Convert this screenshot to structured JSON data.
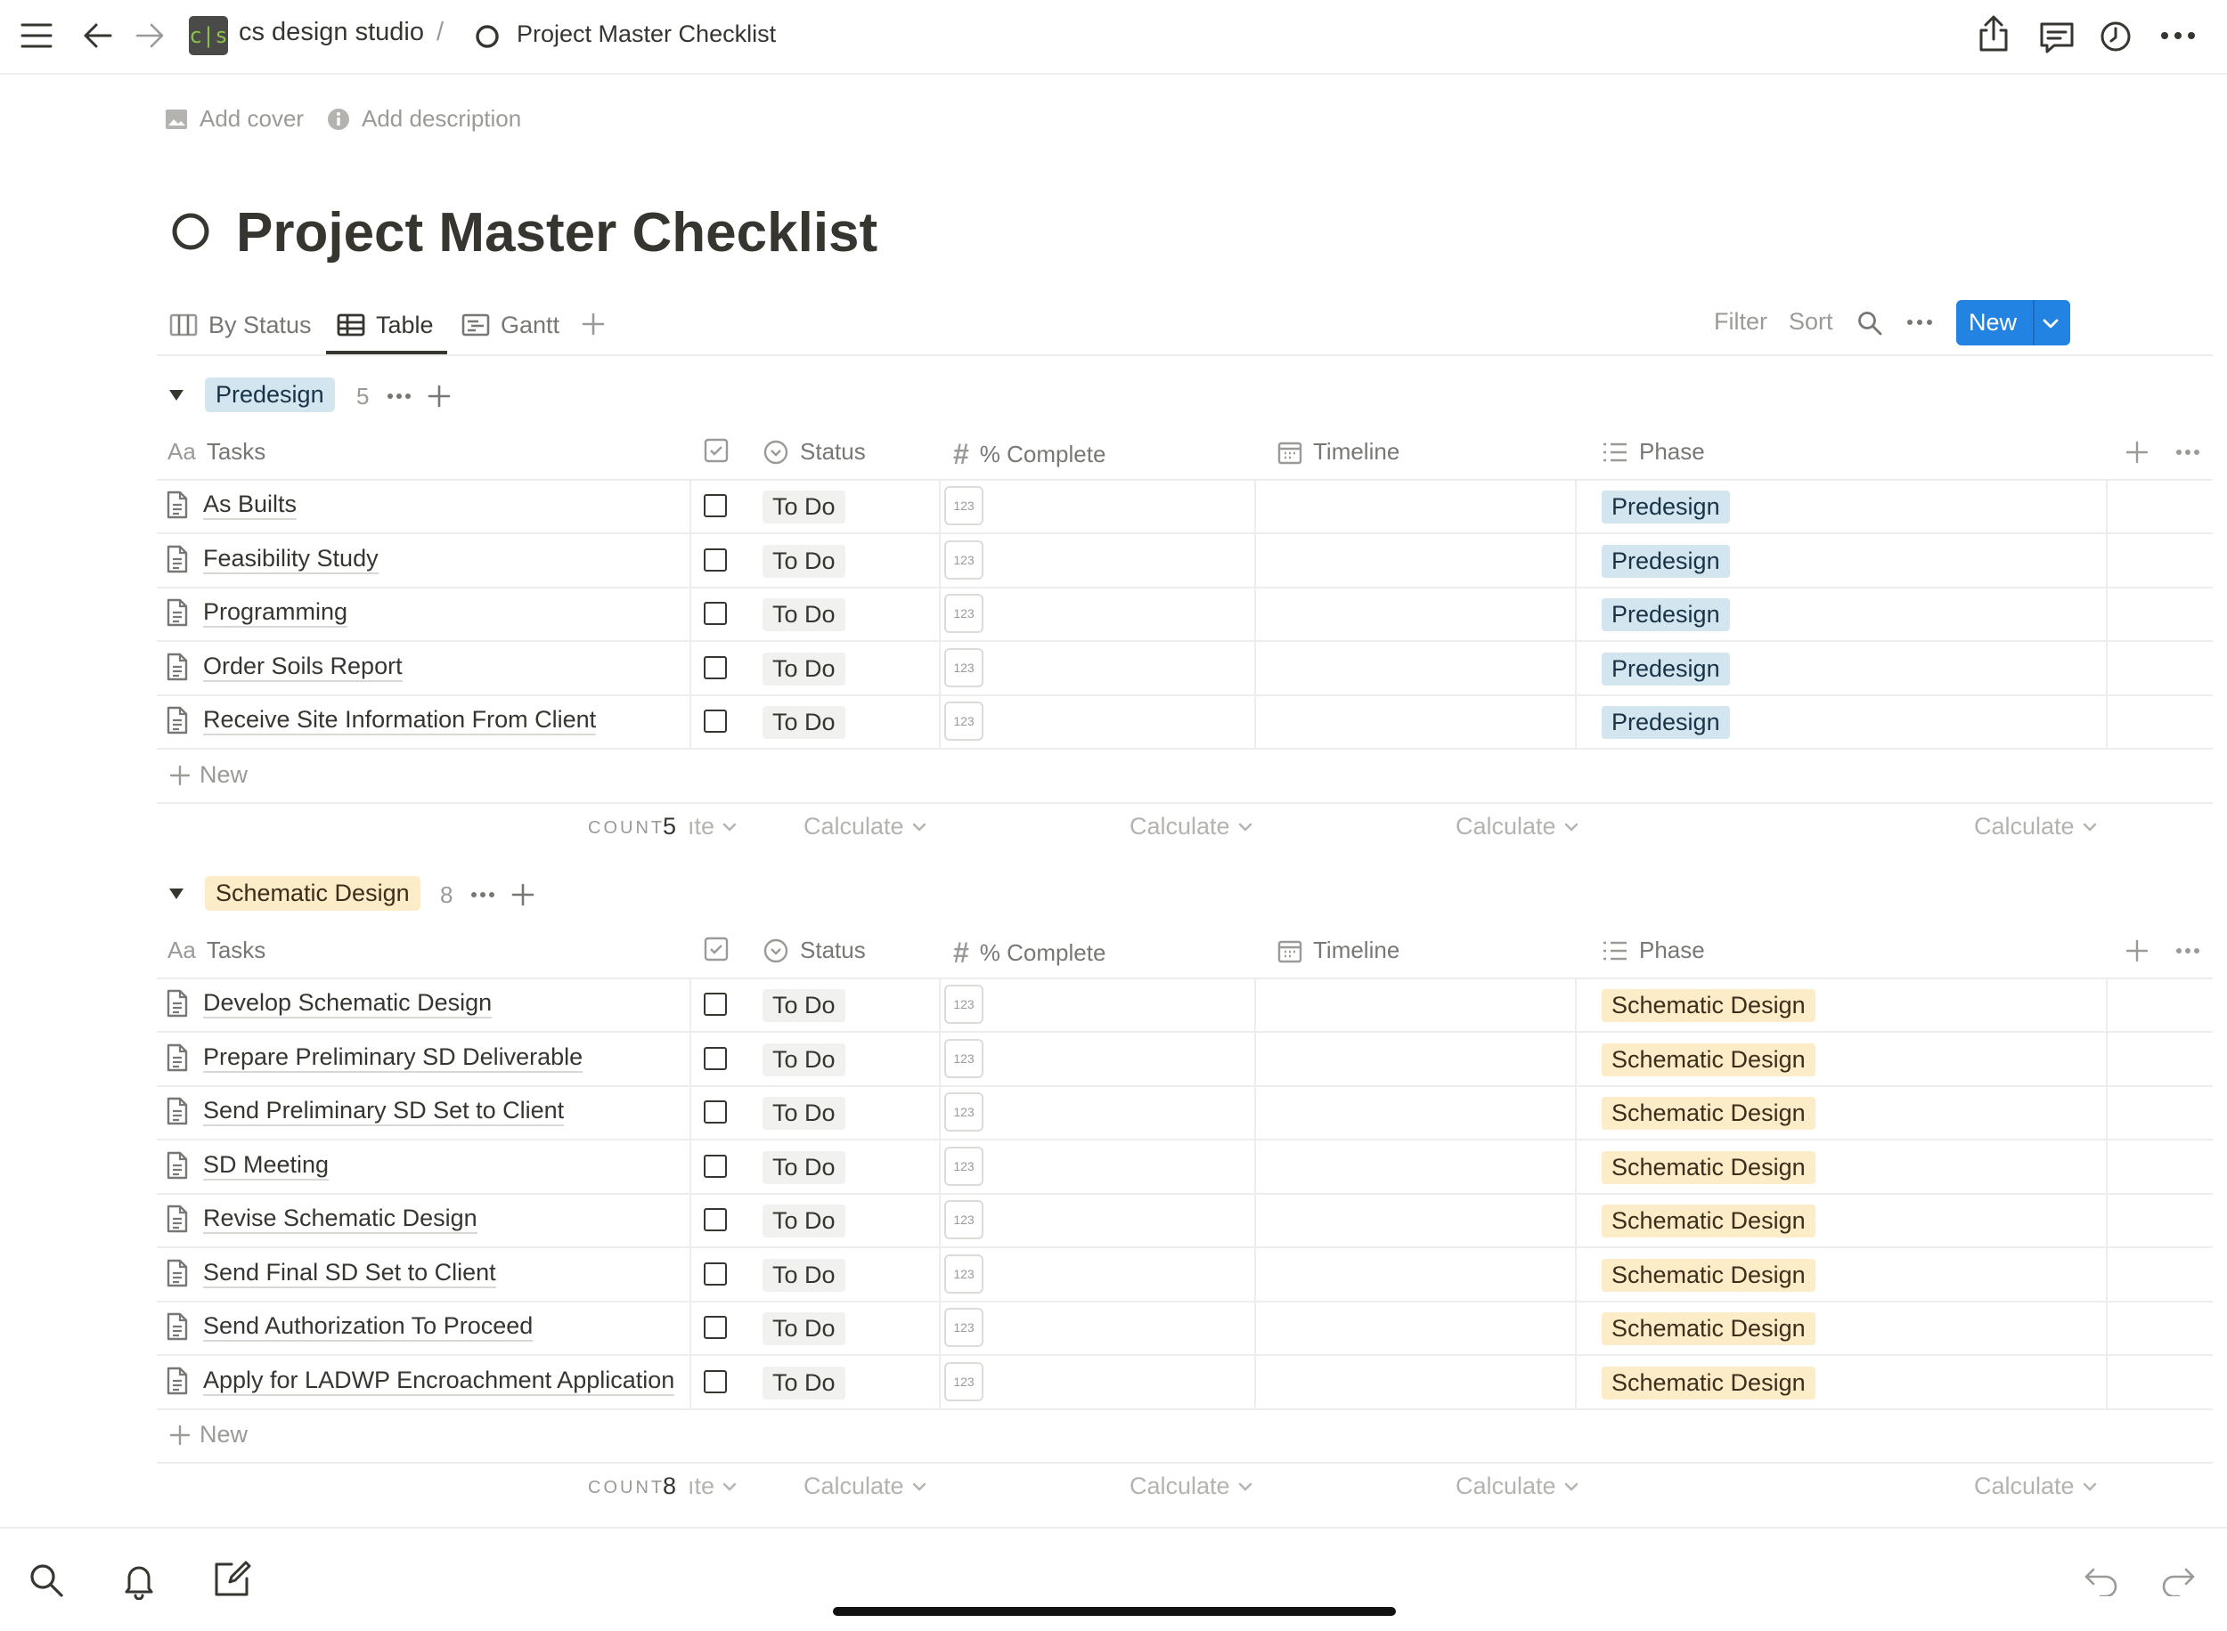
{
  "breadcrumb": {
    "workspace_initials": "c|s",
    "workspace": "cs design studio",
    "separator": "/",
    "page": "Project Master Checklist"
  },
  "page_actions": {
    "add_cover": "Add cover",
    "add_description": "Add description"
  },
  "page_title": "Project Master Checklist",
  "views": [
    {
      "label": "By Status",
      "icon": "board-icon"
    },
    {
      "label": "Table",
      "icon": "table-icon",
      "active": true
    },
    {
      "label": "Gantt",
      "icon": "gantt-icon"
    }
  ],
  "toolbar": {
    "filter": "Filter",
    "sort": "Sort",
    "new": "New"
  },
  "columns": {
    "tasks": "Tasks",
    "status": "Status",
    "complete": "% Complete",
    "timeline": "Timeline",
    "phase": "Phase",
    "tasks_prefix": "Aa"
  },
  "groups": [
    {
      "name": "Predesign",
      "count": "5",
      "color_bg": "#d3e5ef",
      "color_fg": "#183347",
      "rows": [
        {
          "task": "As Builts",
          "status": "To Do",
          "num": "123",
          "phase": "Predesign"
        },
        {
          "task": "Feasibility Study",
          "status": "To Do",
          "num": "123",
          "phase": "Predesign"
        },
        {
          "task": "Programming",
          "status": "To Do",
          "num": "123",
          "phase": "Predesign"
        },
        {
          "task": "Order Soils Report",
          "status": "To Do",
          "num": "123",
          "phase": "Predesign"
        },
        {
          "task": "Receive Site Information From Client",
          "status": "To Do",
          "num": "123",
          "phase": "Predesign"
        }
      ],
      "new_label": "New",
      "count_label": "COUNT",
      "count_value": "5",
      "calc_partial": "ıte",
      "calc_label": "Calculate"
    },
    {
      "name": "Schematic Design",
      "count": "8",
      "color_bg": "#fdecc8",
      "color_fg": "#402c1b",
      "rows": [
        {
          "task": "Develop Schematic Design",
          "status": "To Do",
          "num": "123",
          "phase": "Schematic Design"
        },
        {
          "task": "Prepare Preliminary SD Deliverable",
          "status": "To Do",
          "num": "123",
          "phase": "Schematic Design"
        },
        {
          "task": "Send Preliminary SD Set to Client",
          "status": "To Do",
          "num": "123",
          "phase": "Schematic Design"
        },
        {
          "task": "SD Meeting",
          "status": "To Do",
          "num": "123",
          "phase": "Schematic Design"
        },
        {
          "task": "Revise Schematic Design",
          "status": "To Do",
          "num": "123",
          "phase": "Schematic Design"
        },
        {
          "task": "Send Final SD Set to Client",
          "status": "To Do",
          "num": "123",
          "phase": "Schematic Design"
        },
        {
          "task": "Send Authorization To Proceed",
          "status": "To Do",
          "num": "123",
          "phase": "Schematic Design"
        },
        {
          "task": "Apply for LADWP Encroachment Application",
          "status": "To Do",
          "num": "123",
          "phase": "Schematic Design"
        }
      ],
      "new_label": "New",
      "count_label": "COUNT",
      "count_value": "8",
      "calc_partial": "ıte",
      "calc_label": "Calculate"
    }
  ],
  "colors": {
    "accent": "#2383e2",
    "text": "#37352f",
    "muted": "#9b9a97"
  }
}
